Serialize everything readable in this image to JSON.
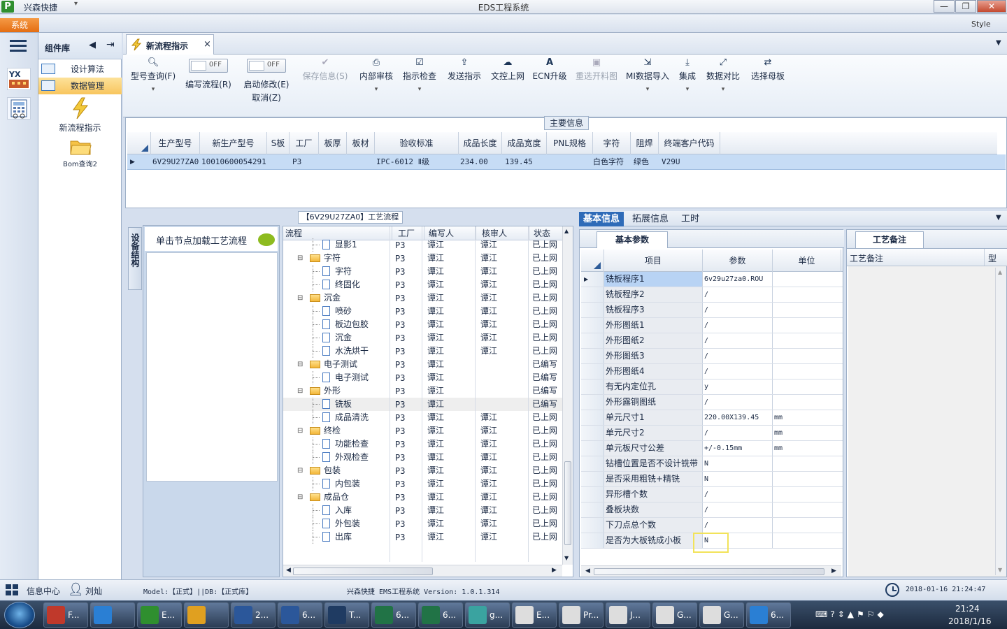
{
  "window": {
    "app_name": "兴森快捷",
    "title": "EDS工程系统",
    "controls": {
      "minimize": "—",
      "restore": "❐",
      "close": "✕"
    }
  },
  "menu": {
    "system_tab": "系统",
    "style_label": "Style"
  },
  "component_library": {
    "title": "组件库",
    "items": [
      {
        "label": "设计算法",
        "icon": "form-icon",
        "selected": false
      },
      {
        "label": "数据管理",
        "icon": "form-icon",
        "selected": true
      }
    ],
    "big_items": [
      {
        "label": "新流程指示",
        "icon": "lightning-icon"
      },
      {
        "label": "Bom查询2",
        "icon": "folder-icon"
      }
    ]
  },
  "doc_tab": {
    "label": "新流程指示",
    "close": "×"
  },
  "ribbon": {
    "buttons": [
      {
        "label": "型号查询(F)",
        "icon": "search-icon",
        "disabled": false,
        "dropdown": true
      },
      {
        "label": "保存信息(S)",
        "icon": "check-icon",
        "disabled": true,
        "dropdown": false
      },
      {
        "label": "内部审核",
        "icon": "printer-icon",
        "disabled": false,
        "dropdown": true
      },
      {
        "label": "指示检查",
        "icon": "checkbox-icon",
        "disabled": false,
        "dropdown": true
      },
      {
        "label": "发送指示",
        "icon": "upload-icon",
        "disabled": false,
        "dropdown": false
      },
      {
        "label": "文控上网",
        "icon": "cloud-upload-icon",
        "disabled": false,
        "dropdown": false
      },
      {
        "label": "ECN升级",
        "icon": "font-icon",
        "disabled": false,
        "dropdown": false
      },
      {
        "label": "重选开料图",
        "icon": "image-icon",
        "disabled": true,
        "dropdown": false
      },
      {
        "label": "MI数据导入",
        "icon": "import-icon",
        "disabled": false,
        "dropdown": true
      },
      {
        "label": "集成",
        "icon": "download-icon",
        "disabled": false,
        "dropdown": true
      },
      {
        "label": "数据对比",
        "icon": "compare-icon",
        "disabled": false,
        "dropdown": true
      },
      {
        "label": "选择母板",
        "icon": "shuffle-icon",
        "disabled": false,
        "dropdown": false
      }
    ],
    "toggles": [
      {
        "state": "OFF",
        "label": "编写流程(R)",
        "label2": ""
      },
      {
        "state": "OFF",
        "label": "启动修改(E)",
        "label2": "取消(Z)"
      }
    ]
  },
  "main_info": {
    "title": "主要信息",
    "columns": [
      "生产型号",
      "新生产型号",
      "S板",
      "工厂",
      "板厚",
      "板材",
      "验收标准",
      "成品长度",
      "成品宽度",
      "PNL规格",
      "字符",
      "阻焊",
      "终端客户代码"
    ],
    "rows": [
      [
        "6V29U27ZA0",
        "10010600054291",
        "",
        "P3",
        "",
        "",
        "IPC-6012 Ⅱ级",
        "234.00",
        "139.45",
        "",
        "白色字符",
        "绿色",
        "V29U"
      ]
    ]
  },
  "process": {
    "title": "【6V29U27ZA0】工艺流程",
    "device_tab": "设备结构",
    "load_hint": "单击节点加载工艺流程",
    "columns": [
      "流程",
      "工厂",
      "编写人",
      "核审人",
      "状态"
    ],
    "rows": [
      {
        "level": 2,
        "name": "显影1",
        "factory": "P3",
        "writer": "谭江",
        "reviewer": "谭江",
        "status": "已上网"
      },
      {
        "level": 1,
        "name": "字符",
        "factory": "P3",
        "writer": "谭江",
        "reviewer": "谭江",
        "status": "已上网"
      },
      {
        "level": 2,
        "name": "字符",
        "factory": "P3",
        "writer": "谭江",
        "reviewer": "谭江",
        "status": "已上网"
      },
      {
        "level": 2,
        "name": "终固化",
        "factory": "P3",
        "writer": "谭江",
        "reviewer": "谭江",
        "status": "已上网"
      },
      {
        "level": 1,
        "name": "沉金",
        "factory": "P3",
        "writer": "谭江",
        "reviewer": "谭江",
        "status": "已上网"
      },
      {
        "level": 2,
        "name": "喷砂",
        "factory": "P3",
        "writer": "谭江",
        "reviewer": "谭江",
        "status": "已上网"
      },
      {
        "level": 2,
        "name": "板边包胶",
        "factory": "P3",
        "writer": "谭江",
        "reviewer": "谭江",
        "status": "已上网"
      },
      {
        "level": 2,
        "name": "沉金",
        "factory": "P3",
        "writer": "谭江",
        "reviewer": "谭江",
        "status": "已上网"
      },
      {
        "level": 2,
        "name": "水洗烘干",
        "factory": "P3",
        "writer": "谭江",
        "reviewer": "谭江",
        "status": "已上网"
      },
      {
        "level": 1,
        "name": "电子测试",
        "factory": "P3",
        "writer": "谭江",
        "reviewer": "",
        "status": "已编写"
      },
      {
        "level": 2,
        "name": "电子测试",
        "factory": "P3",
        "writer": "谭江",
        "reviewer": "",
        "status": "已编写"
      },
      {
        "level": 1,
        "name": "外形",
        "factory": "P3",
        "writer": "谭江",
        "reviewer": "",
        "status": "已编写"
      },
      {
        "level": 2,
        "name": "铣板",
        "factory": "P3",
        "writer": "谭江",
        "reviewer": "",
        "status": "已编写",
        "selected": true
      },
      {
        "level": 2,
        "name": "成品清洗",
        "factory": "P3",
        "writer": "谭江",
        "reviewer": "谭江",
        "status": "已上网"
      },
      {
        "level": 1,
        "name": "终检",
        "factory": "P3",
        "writer": "谭江",
        "reviewer": "谭江",
        "status": "已上网"
      },
      {
        "level": 2,
        "name": "功能检查",
        "factory": "P3",
        "writer": "谭江",
        "reviewer": "谭江",
        "status": "已上网"
      },
      {
        "level": 2,
        "name": "外观检查",
        "factory": "P3",
        "writer": "谭江",
        "reviewer": "谭江",
        "status": "已上网"
      },
      {
        "level": 1,
        "name": "包装",
        "factory": "P3",
        "writer": "谭江",
        "reviewer": "谭江",
        "status": "已上网"
      },
      {
        "level": 2,
        "name": "内包装",
        "factory": "P3",
        "writer": "谭江",
        "reviewer": "谭江",
        "status": "已上网"
      },
      {
        "level": 1,
        "name": "成品仓",
        "factory": "P3",
        "writer": "谭江",
        "reviewer": "谭江",
        "status": "已上网"
      },
      {
        "level": 2,
        "name": "入库",
        "factory": "P3",
        "writer": "谭江",
        "reviewer": "谭江",
        "status": "已上网"
      },
      {
        "level": 2,
        "name": "外包装",
        "factory": "P3",
        "writer": "谭江",
        "reviewer": "谭江",
        "status": "已上网"
      },
      {
        "level": 2,
        "name": "出库",
        "factory": "P3",
        "writer": "谭江",
        "reviewer": "谭江",
        "status": "已上网"
      }
    ]
  },
  "right_tabs": [
    "基本信息",
    "拓展信息",
    "工时"
  ],
  "basic_params": {
    "tab": "基本参数",
    "columns": [
      "项目",
      "参数",
      "单位"
    ],
    "rows": [
      [
        "铣板程序1",
        "6v29u27za0.ROU",
        ""
      ],
      [
        "铣板程序2",
        "/",
        ""
      ],
      [
        "铣板程序3",
        "/",
        ""
      ],
      [
        "外形图纸1",
        "/",
        ""
      ],
      [
        "外形图纸2",
        "/",
        ""
      ],
      [
        "外形图纸3",
        "/",
        ""
      ],
      [
        "外形图纸4",
        "/",
        ""
      ],
      [
        "有无内定位孔",
        "y",
        ""
      ],
      [
        "外形露铜图纸",
        "/",
        ""
      ],
      [
        "单元尺寸1",
        "220.00X139.45",
        "mm"
      ],
      [
        "单元尺寸2",
        "/",
        "mm"
      ],
      [
        "单元板尺寸公差",
        "+/-0.15mm",
        "mm"
      ],
      [
        "钻槽位置是否不设计铣带",
        "N",
        ""
      ],
      [
        "是否采用粗铣+精铣",
        "N",
        ""
      ],
      [
        "异形槽个数",
        "/",
        ""
      ],
      [
        "叠板块数",
        "/",
        ""
      ],
      [
        "下刀点总个数",
        "/",
        ""
      ],
      [
        "是否为大板铣成小板",
        "N",
        ""
      ]
    ]
  },
  "notes": {
    "tab": "工艺备注",
    "col1": "工艺备注",
    "col2": "型"
  },
  "status": {
    "info_center": "信息中心",
    "user": "刘灿",
    "model_db": "Model:【正式】||DB:【正式库】",
    "version": "兴森快捷 EMS工程系统 Version: 1.0.1.314",
    "datetime": "2018-01-16 21:24:47"
  },
  "taskbar": {
    "buttons": [
      "F...",
      "",
      "E...",
      "",
      "2...",
      "6...",
      "T...",
      "6...",
      "6...",
      "g...",
      "E...",
      "Pr...",
      "J...",
      "G...",
      "G...",
      "6..."
    ],
    "clock_time": "21:24",
    "clock_date": "2018/1/16"
  },
  "colors": {
    "accent": "#2e6bb8",
    "system_tab": "#f08a24",
    "selected_row": "#c6dcf5",
    "highlight_box": "#f2e35a"
  }
}
